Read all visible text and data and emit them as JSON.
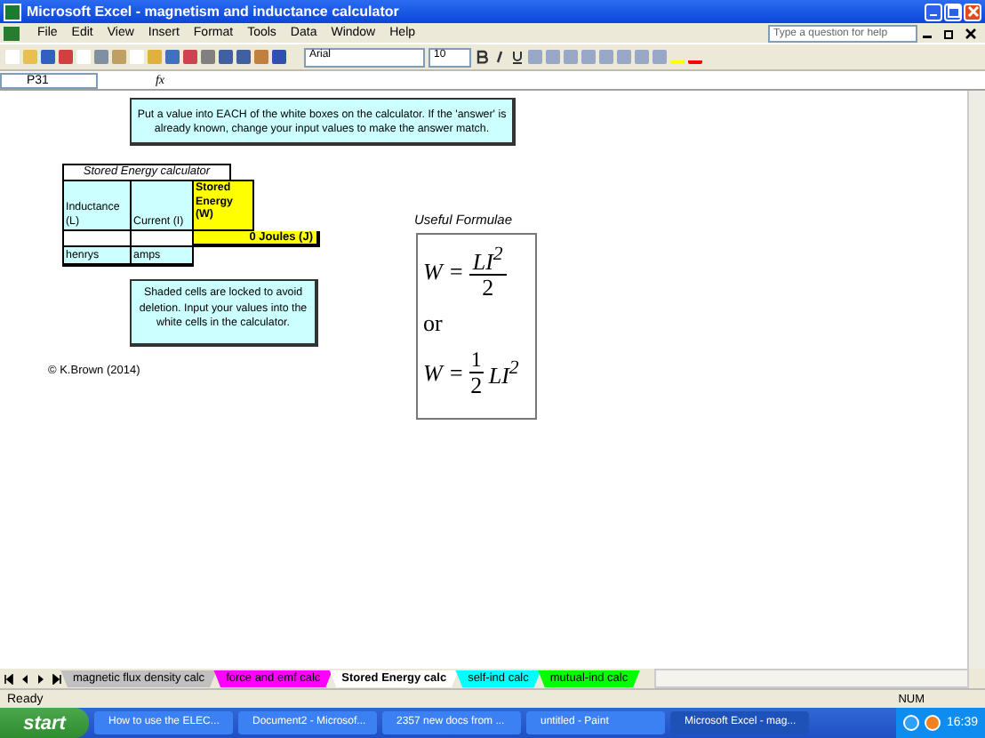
{
  "window": {
    "title": "Microsoft Excel - magnetism and inductance calculator"
  },
  "menu": [
    "File",
    "Edit",
    "View",
    "Insert",
    "Format",
    "Tools",
    "Data",
    "Window",
    "Help"
  ],
  "help_box": {
    "placeholder": "Type a question for help"
  },
  "toolbar": {
    "font": "Arial",
    "size": "10"
  },
  "formula_bar": {
    "name_box": "P31",
    "function_label": "fx"
  },
  "sheet": {
    "instruction": "Put a value into EACH of the white boxes on the calculator. If the 'answer' is already known, change your input values to make the answer match.",
    "calculator": {
      "title": "Stored Energy calculator",
      "headers": [
        "Inductance (L)",
        "Current (I)",
        "Stored Energy (W)"
      ],
      "result": "0 Joules (J)",
      "units": [
        "henrys",
        "amps"
      ]
    },
    "note": "Shaded cells are locked to avoid deletion. Input your values into the white cells in the calculator.",
    "copyright": "© K.Brown (2014)",
    "formulae": {
      "label": "Useful Formulae",
      "items": [
        {
          "kind": "fraction",
          "lhs": "W =",
          "numerator": "LI$^{2}$",
          "denominator": "2"
        },
        {
          "kind": "word",
          "text": "or"
        },
        {
          "kind": "coefficient",
          "lhs": "W =",
          "numerator": "1",
          "denominator": "2",
          "rest": "LI$^{2}$"
        }
      ]
    }
  },
  "sheet_tabs": [
    {
      "label": "magnetic flux density calc",
      "color": "#c0c0c0",
      "selected": false
    },
    {
      "label": "force and emf calc",
      "color": "#ff00ff",
      "selected": false
    },
    {
      "label": "Stored Energy calc",
      "color": "#ffffff",
      "selected": true
    },
    {
      "label": "self-ind calc",
      "color": "#00ffff",
      "selected": false
    },
    {
      "label": "mutual-ind calc",
      "color": "#00ff00",
      "selected": false
    }
  ],
  "status_bar": {
    "status": "Ready",
    "num": "NUM"
  },
  "taskbar": {
    "start": "start",
    "tasks": [
      {
        "label": "How to use the ELEC...",
        "selected": false
      },
      {
        "label": "Document2 - Microsof...",
        "selected": false
      },
      {
        "label": "2357 new docs from ...",
        "selected": false
      },
      {
        "label": "untitled - Paint",
        "selected": false
      },
      {
        "label": "Microsoft Excel - mag...",
        "selected": true
      }
    ],
    "time": "16:39"
  }
}
